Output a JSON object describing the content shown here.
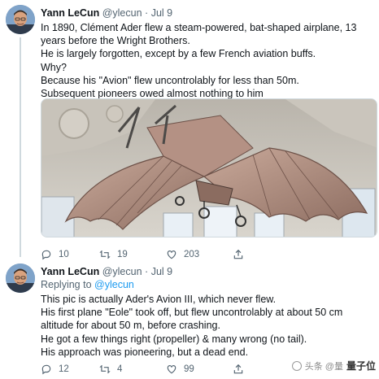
{
  "colors": {
    "text": "#0f1419",
    "muted": "#536471",
    "link": "#1d9bf0",
    "divider": "#cfd9de"
  },
  "tweets": [
    {
      "author_name": "Yann LeCun",
      "handle": "@ylecun",
      "separator": "·",
      "time": "Jul 9",
      "lines": [
        "In 1890, Clément Ader flew a steam-powered, bat-shaped airplane, 13",
        "years before the Wright Brothers.",
        "He is largely forgotten, except by a few French aviation buffs.",
        "Why?",
        "Because his \"Avion\" flew uncontrolably for less than 50m.",
        "Subsequent pioneers owed almost nothing to him"
      ],
      "media_description": "bat-winged aircraft suspended from ornate ceiling",
      "actions": {
        "reply_count": "10",
        "retweet_count": "19",
        "like_count": "203"
      }
    },
    {
      "author_name": "Yann LeCun",
      "handle": "@ylecun",
      "separator": "·",
      "time": "Jul 9",
      "replying_label": "Replying to",
      "replying_to": "@ylecun",
      "lines": [
        "This pic is actually Ader's Avion III, which never flew.",
        "His first plane \"Eole\" took off, but flew uncontrolably at about 50 cm",
        "altitude for about 50 m, before crashing.",
        "He got a few things right (propeller) & many wrong (no tail).",
        "His approach was pioneering, but a dead end."
      ],
      "actions": {
        "reply_count": "12",
        "retweet_count": "4",
        "like_count": "99"
      }
    }
  ],
  "watermark": {
    "prefix": "头条 @量",
    "brand": "量子位"
  },
  "icons": [
    "reply-icon",
    "retweet-icon",
    "like-icon",
    "share-icon"
  ]
}
